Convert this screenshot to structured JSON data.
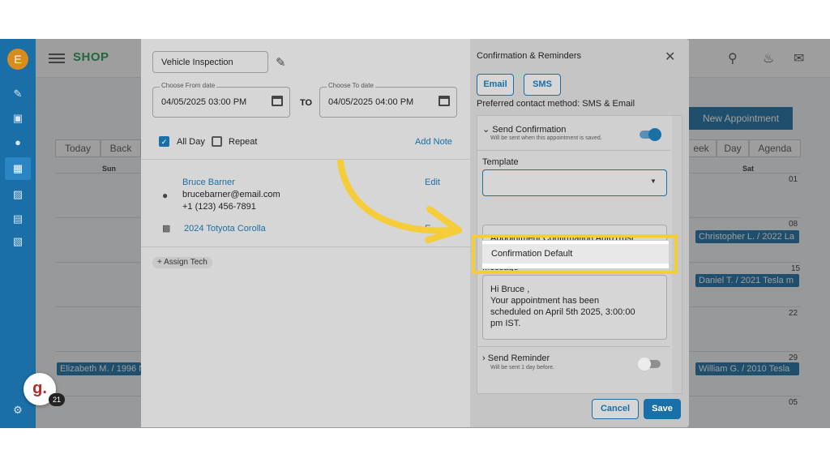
{
  "app": {
    "avatar_letter": "E",
    "logo_text": "SHOP",
    "new_appointment": "New Appointment",
    "view_buttons": [
      "Today",
      "Back",
      "eek",
      "Day",
      "Agenda"
    ],
    "col_headers": [
      "Sun",
      "Sat"
    ],
    "day_numbers": [
      "01",
      "08",
      "15",
      "22",
      "29",
      "05"
    ],
    "events": [
      "Christopher L. / 2022 La",
      "Daniel T. / 2021 Tesla m",
      "William G. / 2010 Tesla",
      "Elizabeth M. / 1996 N"
    ],
    "badge_letter": "g.",
    "badge_count": "21"
  },
  "left_panel": {
    "title_value": "Vehicle Inspection",
    "from_label": "Choose From date",
    "from_value": "04/05/2025 03:00 PM",
    "to_word": "TO",
    "to_label": "Choose To date",
    "to_value": "04/05/2025 04:00 PM",
    "all_day": "All Day",
    "repeat": "Repeat",
    "add_note": "Add Note",
    "customer_name": "Bruce Barner",
    "edit": "Edit",
    "email": "brucebarner@email.com",
    "phone": "+1 (123) 456-7891",
    "vehicle": "2024 Totyota Corolla",
    "vehicle_edit_partial": "E",
    "assign_tech": "Assign Tech"
  },
  "right_panel": {
    "title": "Confirmation & Reminders",
    "email_btn": "Email",
    "sms_btn": "SMS",
    "preferred": "Preferred contact method: SMS & Email",
    "send_confirmation": "Send Confirmation",
    "send_confirmation_sub": "Will be sent when this appointment is saved.",
    "template_label": "Template",
    "dropdown_option": "Confirmation Default",
    "subject_value": "Appointment Confirmation AutoTrust",
    "message_label": "Message",
    "message_lines": [
      "Hi Bruce ,",
      "Your appointment has been",
      "scheduled on  April 5th 2025, 3:00:00",
      "pm IST."
    ],
    "send_reminder": "Send Reminder",
    "send_reminder_sub": "Will be sent 1 day before.",
    "cancel": "Cancel",
    "save": "Save"
  },
  "colors": {
    "accent": "#1a6fa6",
    "highlight": "#f5cd3b",
    "overlay": "#2d2d2d"
  },
  "icons": [
    "hamburger-icon",
    "search-icon",
    "bell-icon",
    "mail-icon",
    "pencil-icon",
    "calendar-icon",
    "person-icon",
    "car-icon",
    "close-icon",
    "arrow-icon",
    "chevron-down-icon",
    "plus-icon"
  ]
}
